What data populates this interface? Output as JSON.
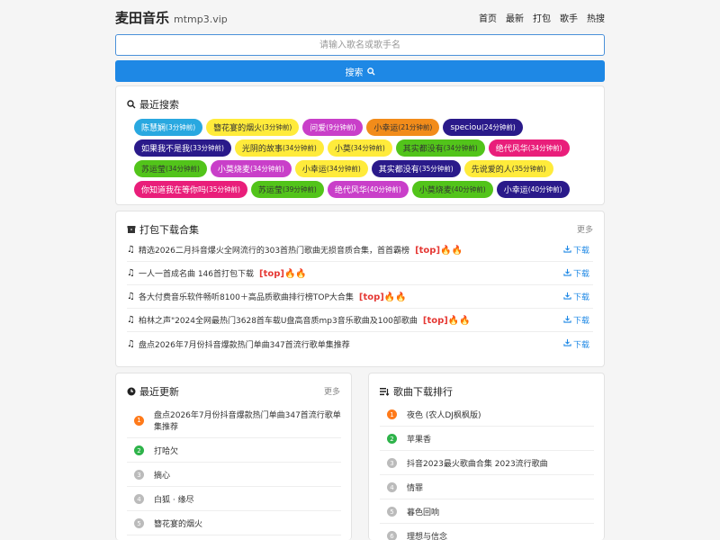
{
  "header": {
    "brand": "麦田音乐",
    "domain": "mtmp3.vip",
    "nav": [
      "首页",
      "最新",
      "打包",
      "歌手",
      "热搜"
    ]
  },
  "search": {
    "placeholder": "请输入歌名或歌手名",
    "button": "搜索"
  },
  "recent_searches": {
    "title": "最近搜索",
    "tags": [
      {
        "name": "陈慧娴",
        "time": "(3分钟前)",
        "bg": "#29a8e0",
        "fg": "#ffffff"
      },
      {
        "name": "簪花宴的烟火",
        "time": "(3分钟前)",
        "bg": "#ffeb3b",
        "fg": "#333333"
      },
      {
        "name": "问爱",
        "time": "(9分钟前)",
        "bg": "#c93fc9",
        "fg": "#ffffff"
      },
      {
        "name": "小幸运",
        "time": "(21分钟前)",
        "bg": "#f28c1a",
        "fg": "#333333"
      },
      {
        "name": "speciou",
        "time": "(24分钟前)",
        "bg": "#2a1a8a",
        "fg": "#ffffff"
      },
      {
        "name": "如果我不是我",
        "time": "(33分钟前)",
        "bg": "#2a1a8a",
        "fg": "#ffffff"
      },
      {
        "name": "光阴的故事",
        "time": "(34分钟前)",
        "bg": "#ffeb3b",
        "fg": "#333333"
      },
      {
        "name": "小莫",
        "time": "(34分钟前)",
        "bg": "#ffeb3b",
        "fg": "#333333"
      },
      {
        "name": "其实都没有",
        "time": "(34分钟前)",
        "bg": "#52c41a",
        "fg": "#333333"
      },
      {
        "name": "绝代风华",
        "time": "(34分钟前)",
        "bg": "#e91e7a",
        "fg": "#ffffff"
      },
      {
        "name": "苏运莹",
        "time": "(34分钟前)",
        "bg": "#52c41a",
        "fg": "#333333"
      },
      {
        "name": "小莫烧麦",
        "time": "(34分钟前)",
        "bg": "#c93fc9",
        "fg": "#ffffff"
      },
      {
        "name": "小幸运",
        "time": "(34分钟前)",
        "bg": "#ffeb3b",
        "fg": "#333333"
      },
      {
        "name": "其实都没有",
        "time": "(35分钟前)",
        "bg": "#2a1a8a",
        "fg": "#ffffff"
      },
      {
        "name": "先说爱的人",
        "time": "(35分钟前)",
        "bg": "#ffeb3b",
        "fg": "#333333"
      },
      {
        "name": "你知道我在等你吗",
        "time": "(35分钟前)",
        "bg": "#e91e7a",
        "fg": "#ffffff"
      },
      {
        "name": "苏运莹",
        "time": "(39分钟前)",
        "bg": "#52c41a",
        "fg": "#333333"
      },
      {
        "name": "绝代风华",
        "time": "(40分钟前)",
        "bg": "#c93fc9",
        "fg": "#ffffff"
      },
      {
        "name": "小莫烧麦",
        "time": "(40分钟前)",
        "bg": "#52c41a",
        "fg": "#333333"
      },
      {
        "name": "小幸运",
        "time": "(40分钟前)",
        "bg": "#2a1a8a",
        "fg": "#ffffff"
      }
    ]
  },
  "packs": {
    "title": "打包下载合集",
    "more": "更多",
    "download_label": "下载",
    "items": [
      {
        "text": "精选2026二月抖音爆火全网流行的303首热门歌曲无损音质合集，首首霸榜",
        "top": "[top]🔥🔥"
      },
      {
        "text": "一人一首成名曲 146首打包下载",
        "top": "[top]🔥🔥"
      },
      {
        "text": "各大付费音乐软件畅听8100＋高品质歌曲排行榜TOP大合集",
        "top": "[top]🔥🔥"
      },
      {
        "text": "柏林之声\"2024全网最热门3628首车载U盘高音质mp3音乐歌曲及100部歌曲",
        "top": "[top]🔥🔥"
      },
      {
        "text": "盘点2026年7月份抖音爆款热门单曲347首流行歌单集推荐",
        "top": ""
      }
    ]
  },
  "updates": {
    "title": "最近更新",
    "more": "更多",
    "items": [
      {
        "num": "1",
        "text": "盘点2026年7月份抖音爆款热门单曲347首流行歌单集推荐"
      },
      {
        "num": "2",
        "text": "打哈欠"
      },
      {
        "num": "3",
        "text": "摘心"
      },
      {
        "num": "4",
        "text": "白狐 · 缘尽"
      },
      {
        "num": "5",
        "text": "簪花宴的烟火"
      }
    ]
  },
  "ranks": {
    "title": "歌曲下载排行",
    "items": [
      {
        "num": "1",
        "text": "夜色 (农人DJ枫枫版)"
      },
      {
        "num": "2",
        "text": "苹果香"
      },
      {
        "num": "3",
        "text": "抖音2023最火歌曲合集 2023流行歌曲"
      },
      {
        "num": "4",
        "text": "情罪"
      },
      {
        "num": "5",
        "text": "暮色回响"
      },
      {
        "num": "6",
        "text": "理想与信念"
      }
    ]
  }
}
